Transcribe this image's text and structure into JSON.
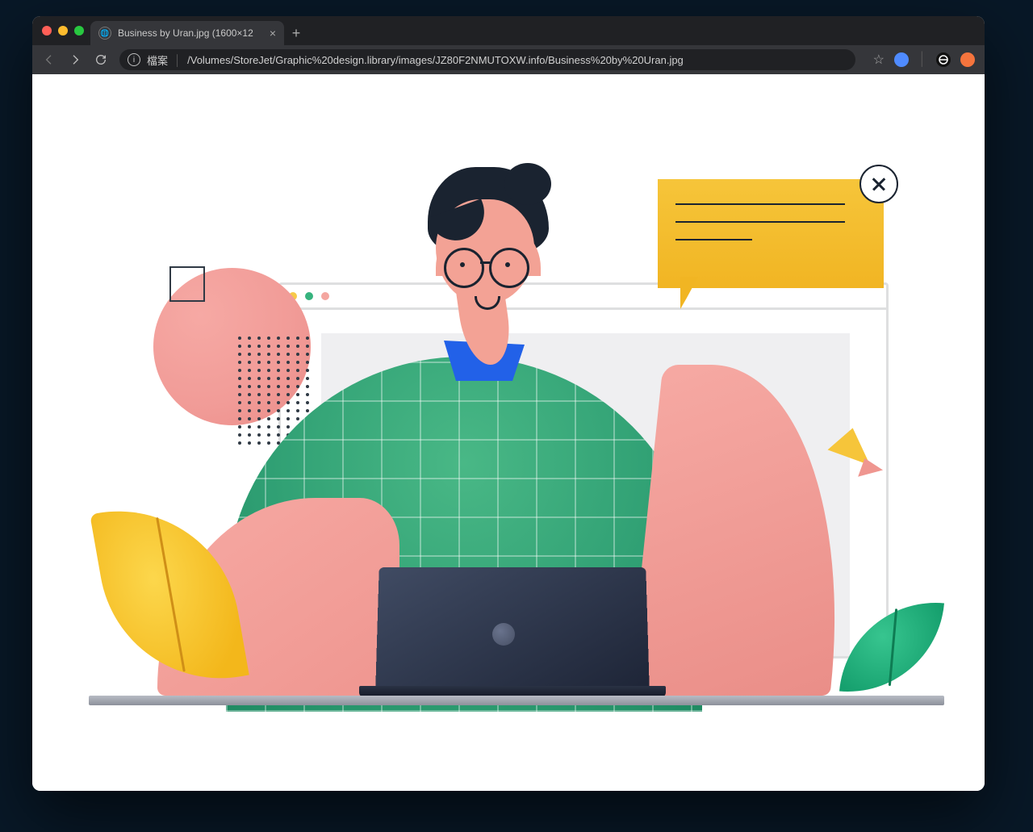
{
  "tab_title": "Business by Uran.jpg (1600×12",
  "url_prefix": "檔案",
  "url_path": "/Volumes/StoreJet/Graphic%20design.library/images/JZ80F2NMUTOXW.info/Business%20by%20Uran.jpg"
}
